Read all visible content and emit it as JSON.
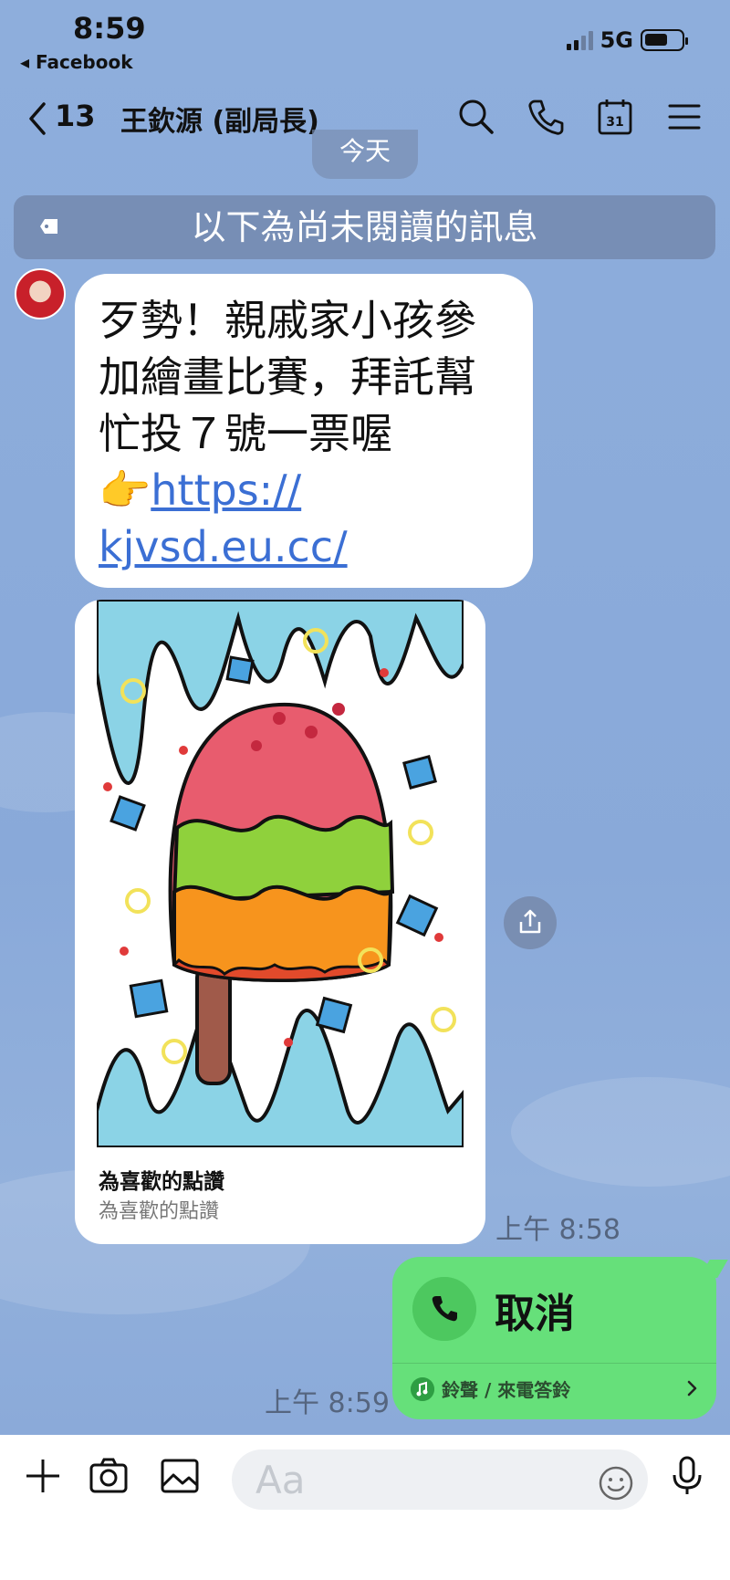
{
  "status_bar": {
    "time": "8:59",
    "back_app": "◂ Facebook",
    "network": "5G"
  },
  "nav": {
    "unread_count": "13",
    "title": "王欽源 (副局長)"
  },
  "date_chip": "今天",
  "unread_banner": "以下為尚未閱讀的訊息",
  "messages": {
    "incoming_text": {
      "lines": [
        "歹勢！親戚家小孩參",
        "加繪畫比賽，拜託幫",
        "忙投７號一票喔"
      ],
      "emoji": "👉",
      "link_line1": "https://",
      "link_line2": "kjvsd.eu.cc/"
    },
    "card": {
      "title": "為喜歡的點讚",
      "subtitle": "為喜歡的點讚"
    },
    "incoming_time": "上午 8:58",
    "call": {
      "label": "取消",
      "ringtone": "鈴聲 / 來電答鈴"
    },
    "outgoing_time": "上午 8:59"
  },
  "input_bar": {
    "placeholder": "Aa"
  },
  "colors": {
    "background": "#8aaad9",
    "outgoing_bubble": "#66e07a",
    "link": "#3b6fd4"
  },
  "icons": [
    "back-chevron-icon",
    "search-icon",
    "phone-icon",
    "calendar-icon",
    "menu-icon",
    "share-icon",
    "plus-icon",
    "camera-icon",
    "image-icon",
    "emoji-icon",
    "microphone-icon"
  ]
}
